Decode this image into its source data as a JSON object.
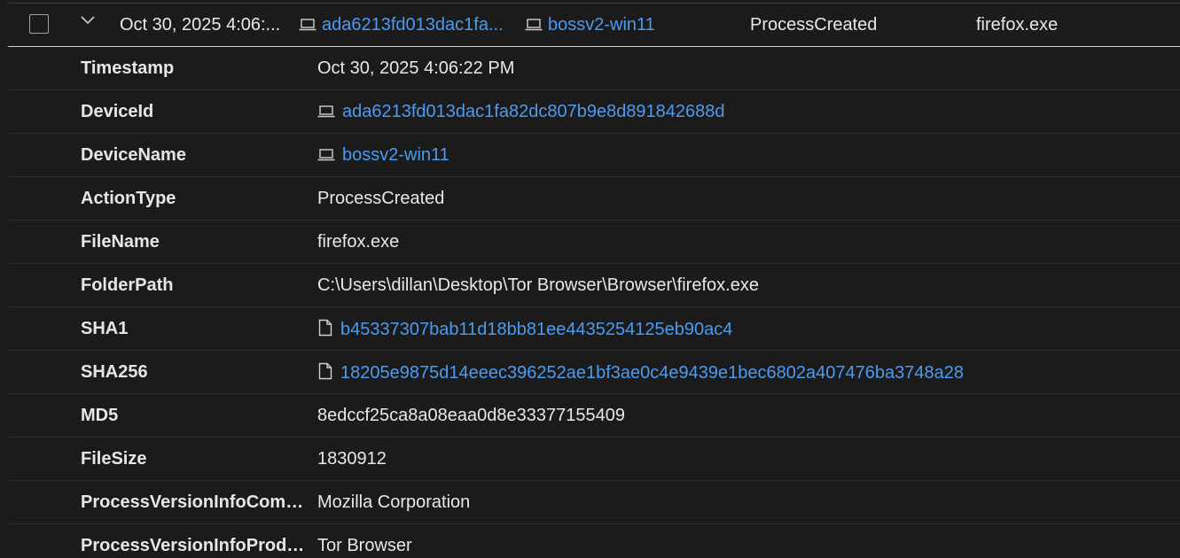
{
  "summary": {
    "timestamp": "Oct 30, 2025 4:06:...",
    "device_id": "ada6213fd013dac1fa...",
    "device_name": "bossv2-win11",
    "action_type": "ProcessCreated",
    "file_name": "firefox.exe"
  },
  "details": [
    {
      "key": "Timestamp",
      "value": "Oct 30, 2025 4:06:22 PM",
      "icon": "",
      "link": false
    },
    {
      "key": "DeviceId",
      "value": "ada6213fd013dac1fa82dc807b9e8d891842688d",
      "icon": "laptop-icon",
      "link": true
    },
    {
      "key": "DeviceName",
      "value": "bossv2-win11",
      "icon": "laptop-icon",
      "link": true
    },
    {
      "key": "ActionType",
      "value": "ProcessCreated",
      "icon": "",
      "link": false
    },
    {
      "key": "FileName",
      "value": "firefox.exe",
      "icon": "",
      "link": false
    },
    {
      "key": "FolderPath",
      "value": "C:\\Users\\dillan\\Desktop\\Tor Browser\\Browser\\firefox.exe",
      "icon": "",
      "link": false
    },
    {
      "key": "SHA1",
      "value": "b45337307bab11d18bb81ee4435254125eb90ac4",
      "icon": "file-icon",
      "link": true
    },
    {
      "key": "SHA256",
      "value": "18205e9875d14eeec396252ae1bf3ae0c4e9439e1bec6802a407476ba3748a28",
      "icon": "file-icon",
      "link": true
    },
    {
      "key": "MD5",
      "value": "8edccf25ca8a08eaa0d8e33377155409",
      "icon": "",
      "link": false
    },
    {
      "key": "FileSize",
      "value": "1830912",
      "icon": "",
      "link": false
    },
    {
      "key": "ProcessVersionInfoComp...",
      "value": "Mozilla Corporation",
      "icon": "",
      "link": false
    },
    {
      "key": "ProcessVersionInfoProdu...",
      "value": "Tor Browser",
      "icon": "",
      "link": false
    }
  ],
  "colors": {
    "background": "#1b1b1b",
    "link": "#4c9bf0",
    "text": "#e8e8e8",
    "divider": "#2e2e2e"
  }
}
